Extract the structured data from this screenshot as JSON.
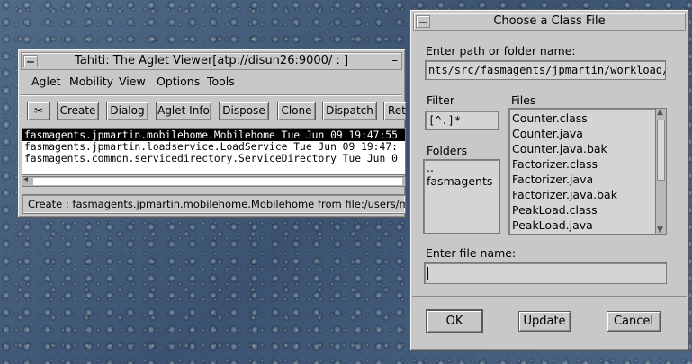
{
  "viewer": {
    "title": "Tahiti: The Aglet Viewer[atp://disun26:9000/ : ]",
    "menu": [
      "Aglet",
      "Mobility",
      "View",
      "Options",
      "Tools"
    ],
    "toolbar": {
      "cut_glyph": "✂",
      "create": "Create",
      "dialog": "Dialog",
      "aglet_info": "Aglet Info",
      "dispose": "Dispose",
      "clone": "Clone",
      "dispatch": "Dispatch",
      "retract": "Retr"
    },
    "list": [
      "fasmagents.jpmartin.mobilehome.Mobilehome Tue Jun 09 19:47:55",
      "fasmagents.jpmartin.loadservice.LoadService Tue Jun 09 19:47:",
      "fasmagents.common.servicedirectory.ServiceDirectory Tue Jun 0"
    ],
    "status": "Create : fasmagents.jpmartin.mobilehome.Mobilehome from file:/users/magents/"
  },
  "dialog": {
    "title": "Choose a Class File",
    "path_label": "Enter path or folder name:",
    "path_value": "nts/src/fasmagents/jpmartin/workload/",
    "filter_label": "Filter",
    "filter_value": "[^.]*",
    "files_label": "Files",
    "files": [
      "Counter.class",
      "Counter.java",
      "Counter.java.bak",
      "Factorizer.class",
      "Factorizer.java",
      "Factorizer.java.bak",
      "PeakLoad.class",
      "PeakLoad.java"
    ],
    "folders_label": "Folders",
    "folders": [
      "..",
      "fasmagents"
    ],
    "filename_label": "Enter file name:",
    "filename_value": "",
    "ok": "OK",
    "update": "Update",
    "cancel": "Cancel"
  }
}
